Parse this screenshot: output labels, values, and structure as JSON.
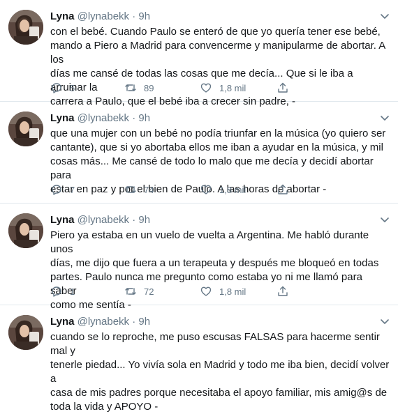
{
  "author": {
    "name": "Lyna",
    "handle": "@lynabekk",
    "dot": "·"
  },
  "tweets": [
    {
      "time": "9h",
      "text": "con el bebé. Cuando Paulo se enteró de que yo quería tener ese bebé,\nmando a Piero a Madrid para convencerme y manipularme de abortar. A los\ndías me cansé de todas las cosas que me decía... Que si le iba a arruinar la\ncarrera a Paulo, que el bebé iba a crecer sin padre, -",
      "replies": "5",
      "retweets": "89",
      "likes": "1,8 mil"
    },
    {
      "time": "9h",
      "text": "que una mujer con un bebé no podía triunfar en la música (yo quiero ser\ncantante), que si yo abortaba ellos me iban a ayudar en la música, y mil\ncosas más... Me cansé de todo lo malo que me decía y decidí abortar para\nestar en paz y por el bien de Paulo. A las horas de abortar -",
      "replies": "7",
      "retweets": "74",
      "likes": "1,8 mil"
    },
    {
      "time": "9h",
      "text": "Piero ya estaba en un vuelo de vuelta a Argentina. Me habló durante unos\ndías, me dijo que fuera a un terapeuta y después me bloqueó en todas\npartes. Paulo nunca me pregunto como estaba yo ni me llamó para saber\ncomo me sentía -",
      "replies": "1",
      "retweets": "72",
      "likes": "1,8 mil"
    },
    {
      "time": "9h",
      "text": "cuando se lo reproche, me puso escusas FALSAS para hacerme sentir mal y\ntenerle piedad... Yo vivía sola en Madrid y todo me iba bien, decidí volver a\ncasa de mis padres porque necesitaba el apoyo familiar, mis amig@s de\ntoda la vida y APOYO -"
    }
  ]
}
